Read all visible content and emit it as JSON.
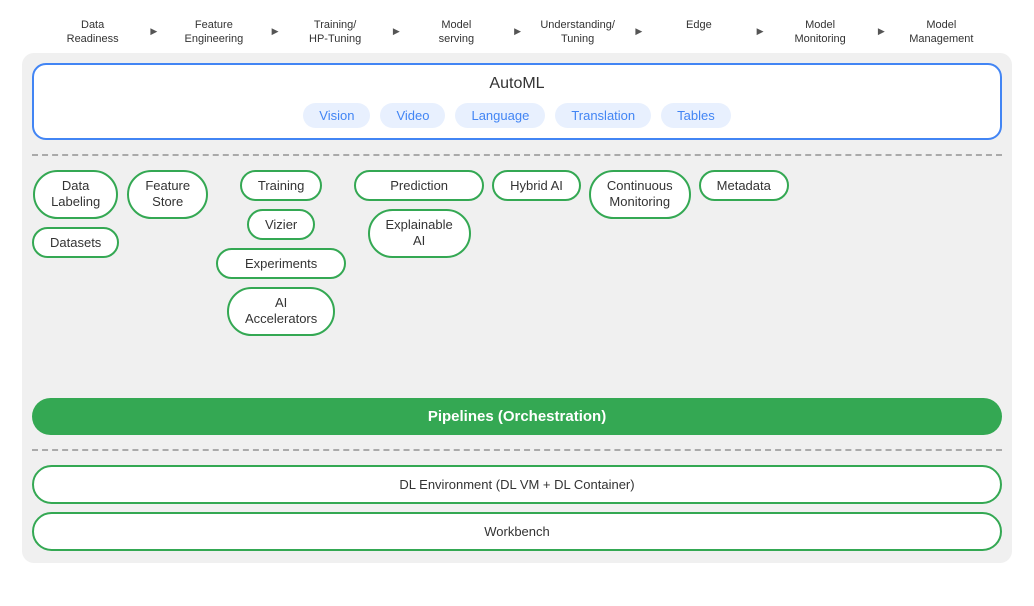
{
  "header": {
    "labels": [
      {
        "text": "Data\nReadiness",
        "id": "data-readiness"
      },
      {
        "text": "Feature\nEngineering",
        "id": "feature-engineering"
      },
      {
        "text": "Training/\nHP-Tuning",
        "id": "training-hp-tuning"
      },
      {
        "text": "Model\nserving",
        "id": "model-serving"
      },
      {
        "text": "Understanding/\nTuning",
        "id": "understanding-tuning"
      },
      {
        "text": "Edge",
        "id": "edge"
      },
      {
        "text": "Model\nMonitoring",
        "id": "model-monitoring"
      },
      {
        "text": "Model\nManagement",
        "id": "model-management"
      }
    ]
  },
  "automl": {
    "title": "AutoML",
    "chips": [
      "Vision",
      "Video",
      "Language",
      "Translation",
      "Tables"
    ]
  },
  "components": {
    "row1": [
      {
        "text": "Data\nLabeling",
        "multiline": true
      },
      {
        "text": "Feature\nStore",
        "multiline": true
      },
      {
        "text": "Training",
        "multiline": false
      },
      {
        "text": "Prediction",
        "multiline": false
      },
      {
        "text": "Hybrid AI",
        "multiline": false
      },
      {
        "text": "Continuous\nMonitoring",
        "multiline": true
      },
      {
        "text": "Metadata",
        "multiline": false
      }
    ],
    "row2": [
      {
        "text": "Datasets",
        "multiline": false
      },
      {
        "text": "Vizier",
        "multiline": false
      },
      {
        "text": "Explainable\nAI",
        "multiline": true
      }
    ],
    "row3": [
      {
        "text": "Experiments",
        "multiline": false
      }
    ],
    "row4": [
      {
        "text": "AI\nAccelerators",
        "multiline": true
      }
    ]
  },
  "pipelines": {
    "label": "Pipelines (Orchestration)"
  },
  "bottom": {
    "dl_env": "DL Environment (DL VM + DL Container)",
    "workbench": "Workbench"
  }
}
